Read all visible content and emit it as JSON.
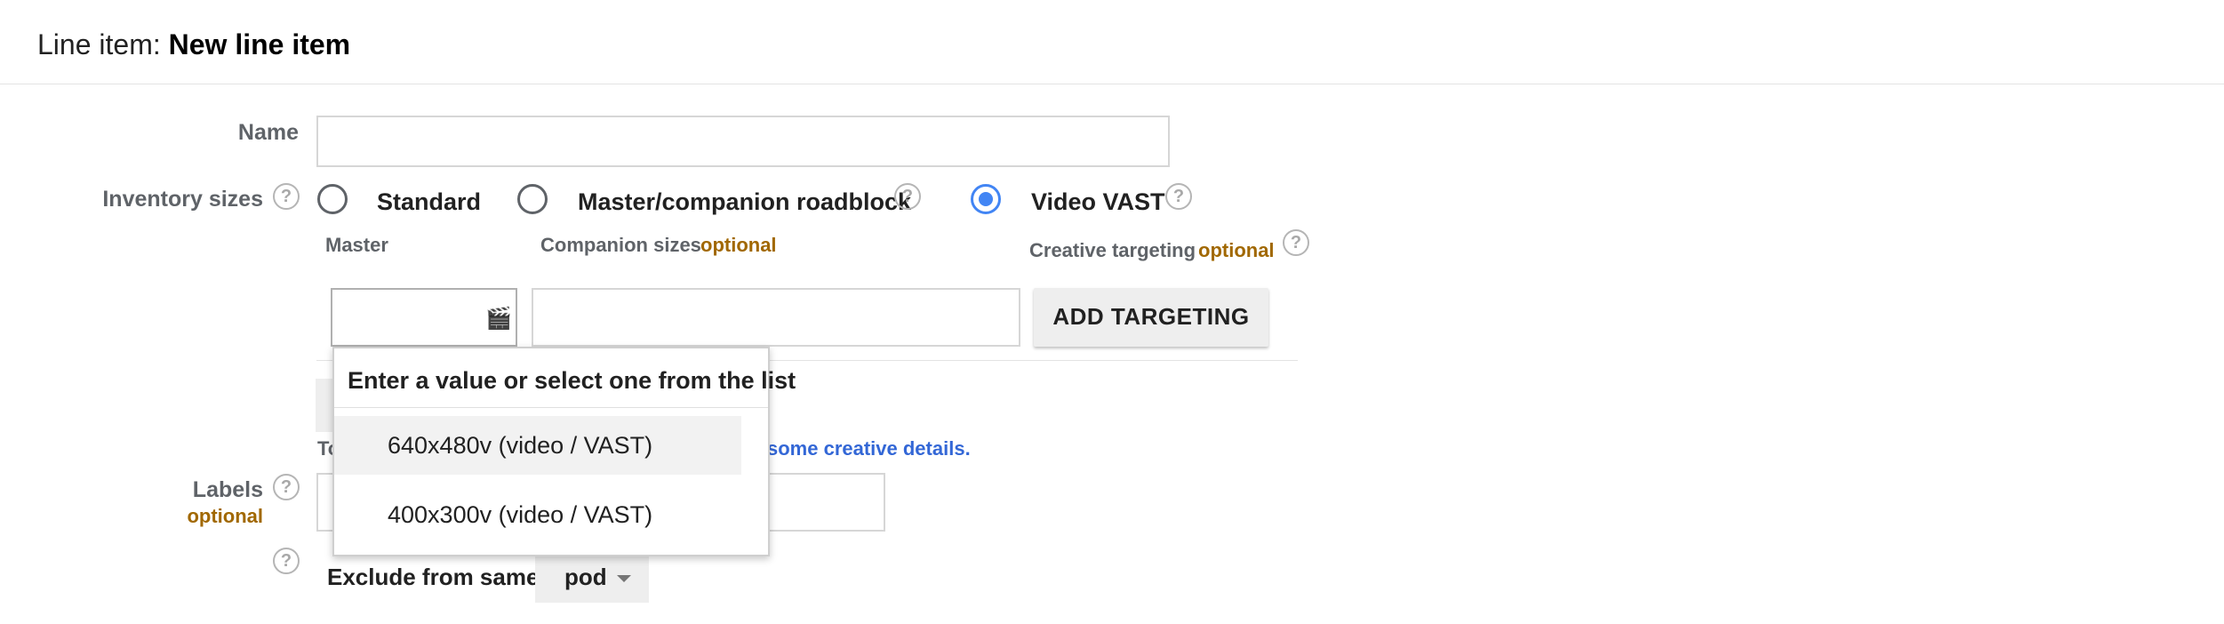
{
  "header": {
    "title_prefix": "Line item: ",
    "title_value": "New line item"
  },
  "name_field": {
    "label": "Name",
    "value": "",
    "placeholder": ""
  },
  "inventory_sizes": {
    "label": "Inventory sizes",
    "help_icon": "?",
    "options": [
      {
        "label": "Standard",
        "checked": false
      },
      {
        "label": "Master/companion roadblock",
        "checked": false
      },
      {
        "label": "Video VAST",
        "checked": true
      }
    ],
    "master_label": "Master",
    "companion_label": "Companion sizes",
    "companion_optional": "optional",
    "targeting_label": "Creative targeting",
    "targeting_optional": "optional",
    "master_value": "",
    "companion_value": "",
    "add_targeting_label": "ADD TARGETING",
    "master_icon": "clapperboard-icon"
  },
  "creative_details": {
    "prefix_visible": "To",
    "link_text": "some creative details."
  },
  "dropdown": {
    "header": "Enter a value or select one from the list",
    "options": [
      {
        "label": "640x480v (video / VAST)",
        "highlighted": true
      },
      {
        "label": "400x300v (video / VAST)",
        "highlighted": false
      }
    ]
  },
  "labels_field": {
    "label": "Labels",
    "optional": "optional",
    "value": ""
  },
  "exclude": {
    "label": "Exclude from same",
    "select_value": "pod"
  },
  "colors": {
    "accent_blue": "#4285f4",
    "optional_gold": "#a16800",
    "link_blue": "#3367d6"
  }
}
